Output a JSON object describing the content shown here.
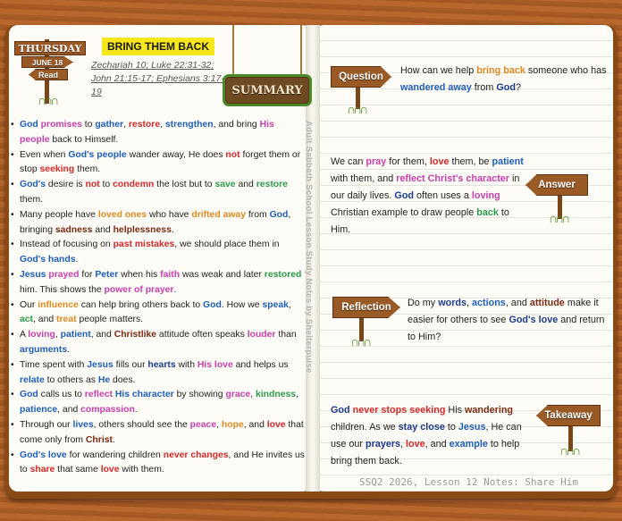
{
  "header": {
    "day": "THURSDAY",
    "date": "JUNE 18",
    "read_label": "Read",
    "title": "BRING THEM BACK",
    "scripture": "Zechariah 10; Luke 22:31-32; John 21:15-17; Ephesians 3:17-19",
    "summary_label": "SUMMARY",
    "vertical_text": "Adult Sabbath School Lesson Study Notes by Shelterpuise"
  },
  "bullets": [
    [
      [
        "God",
        "blue"
      ],
      [
        " "
      ],
      [
        "promises",
        "pink"
      ],
      [
        " to "
      ],
      [
        "gather",
        "blue"
      ],
      [
        ", "
      ],
      [
        "restore",
        "red"
      ],
      [
        ", "
      ],
      [
        "strengthen",
        "blue"
      ],
      [
        ", and bring "
      ],
      [
        "His people",
        "pink"
      ],
      [
        " back to Himself."
      ]
    ],
    [
      [
        "Even when "
      ],
      [
        "God's people",
        "blue"
      ],
      [
        " wander away, He does "
      ],
      [
        "not",
        "red"
      ],
      [
        " forget them or stop "
      ],
      [
        "seeking",
        "red"
      ],
      [
        " them."
      ]
    ],
    [
      [
        "God's",
        "blue"
      ],
      [
        " desire is "
      ],
      [
        "not",
        "red"
      ],
      [
        " to "
      ],
      [
        "condemn",
        "red"
      ],
      [
        " the lost but to "
      ],
      [
        "save",
        "green"
      ],
      [
        " and "
      ],
      [
        "restore",
        "green"
      ],
      [
        " them."
      ]
    ],
    [
      [
        "Many people have "
      ],
      [
        "loved ones",
        "orange"
      ],
      [
        " who have "
      ],
      [
        "drifted away",
        "orange"
      ],
      [
        " from "
      ],
      [
        "God",
        "blue"
      ],
      [
        ", bringing "
      ],
      [
        "sadness",
        "dark"
      ],
      [
        " and "
      ],
      [
        "helplessness",
        "dark"
      ],
      [
        "."
      ]
    ],
    [
      [
        "Instead of focusing on "
      ],
      [
        "past mistakes",
        "red"
      ],
      [
        ", we should place them in "
      ],
      [
        "God's hands",
        "blue"
      ],
      [
        "."
      ]
    ],
    [
      [
        "Jesus",
        "blue"
      ],
      [
        " "
      ],
      [
        "prayed",
        "pink"
      ],
      [
        " for "
      ],
      [
        "Peter",
        "blue"
      ],
      [
        " when his "
      ],
      [
        "faith",
        "pink"
      ],
      [
        " was weak and later "
      ],
      [
        "restored",
        "green"
      ],
      [
        " him. This shows the "
      ],
      [
        "power of prayer",
        "pink"
      ],
      [
        "."
      ]
    ],
    [
      [
        "Our "
      ],
      [
        "influence",
        "orange"
      ],
      [
        " can help bring others back to "
      ],
      [
        "God",
        "blue"
      ],
      [
        ". How we "
      ],
      [
        "speak",
        "blue"
      ],
      [
        ", "
      ],
      [
        "act",
        "green"
      ],
      [
        ", and "
      ],
      [
        "treat",
        "orange"
      ],
      [
        " people matters."
      ]
    ],
    [
      [
        "A "
      ],
      [
        "loving",
        "pink"
      ],
      [
        ", "
      ],
      [
        "patient",
        "blue"
      ],
      [
        ", and "
      ],
      [
        "Christlike",
        "dark"
      ],
      [
        " attitude often speaks "
      ],
      [
        "louder",
        "pink"
      ],
      [
        " than "
      ],
      [
        "arguments",
        "blue"
      ],
      [
        "."
      ]
    ],
    [
      [
        "Time spent with "
      ],
      [
        "Jesus",
        "blue"
      ],
      [
        " fills our "
      ],
      [
        "hearts",
        "dblue"
      ],
      [
        " with "
      ],
      [
        "His love",
        "pink"
      ],
      [
        " and helps us "
      ],
      [
        "relate",
        "blue"
      ],
      [
        " to others as "
      ],
      [
        "He",
        "blue"
      ],
      [
        " does."
      ]
    ],
    [
      [
        "God",
        "blue"
      ],
      [
        " calls us to "
      ],
      [
        "reflect",
        "pink"
      ],
      [
        " "
      ],
      [
        "His character",
        "blue"
      ],
      [
        " by showing "
      ],
      [
        "grace",
        "pink"
      ],
      [
        ", "
      ],
      [
        "kindness",
        "green"
      ],
      [
        ", "
      ],
      [
        "patience",
        "blue"
      ],
      [
        ", and "
      ],
      [
        "compassion",
        "pink"
      ],
      [
        "."
      ]
    ],
    [
      [
        "Through our "
      ],
      [
        "lives",
        "blue"
      ],
      [
        ", others should see the "
      ],
      [
        "peace",
        "pink"
      ],
      [
        ", "
      ],
      [
        "hope",
        "orange"
      ],
      [
        ", and "
      ],
      [
        "love",
        "red"
      ],
      [
        " that come only from "
      ],
      [
        "Christ",
        "dark"
      ],
      [
        "."
      ]
    ],
    [
      [
        "God's love",
        "blue"
      ],
      [
        " for wandering children "
      ],
      [
        "never changes",
        "red"
      ],
      [
        ", and He invites us to "
      ],
      [
        "share",
        "red"
      ],
      [
        " that same "
      ],
      [
        "love",
        "red"
      ],
      [
        " with them."
      ]
    ]
  ],
  "question": {
    "label": "Question",
    "text": [
      [
        "How can we help "
      ],
      [
        "bring back",
        "orange"
      ],
      [
        " someone who has "
      ],
      [
        "wandered away",
        "blue"
      ],
      [
        " from "
      ],
      [
        "God",
        "dblue"
      ],
      [
        "?"
      ]
    ]
  },
  "answer": {
    "label": "Answer",
    "text": [
      [
        "We can "
      ],
      [
        "pray",
        "pink"
      ],
      [
        " for them, "
      ],
      [
        "love",
        "red"
      ],
      [
        " them, be "
      ],
      [
        "patient",
        "blue"
      ],
      [
        " with them, and "
      ],
      [
        "reflect Christ's character",
        "pink"
      ],
      [
        " in our daily lives. "
      ],
      [
        "God",
        "dblue"
      ],
      [
        " often uses a "
      ],
      [
        "loving",
        "pink"
      ],
      [
        " Christian example to draw people "
      ],
      [
        "back",
        "green"
      ],
      [
        " to Him."
      ]
    ]
  },
  "reflection": {
    "label": "Reflection",
    "text": [
      [
        "Do my "
      ],
      [
        "words",
        "dblue"
      ],
      [
        ", "
      ],
      [
        "actions",
        "blue"
      ],
      [
        ", and "
      ],
      [
        "attitude",
        "dark"
      ],
      [
        " make it easier for others to see "
      ],
      [
        "God's love",
        "dblue"
      ],
      [
        " and return to Him?"
      ]
    ]
  },
  "takeaway": {
    "label": "Takeaway",
    "text": [
      [
        "God",
        "dblue"
      ],
      [
        " "
      ],
      [
        "never stops seeking",
        "red"
      ],
      [
        " His "
      ],
      [
        "wandering",
        "dark"
      ],
      [
        " children. As we "
      ],
      [
        "stay close",
        "dblue"
      ],
      [
        " to "
      ],
      [
        "Jesus",
        "blue"
      ],
      [
        ", He can use our "
      ],
      [
        "prayers",
        "dblue"
      ],
      [
        ", "
      ],
      [
        "love",
        "red"
      ],
      [
        ", and "
      ],
      [
        "example",
        "blue"
      ],
      [
        " to help bring them back."
      ]
    ]
  },
  "footer": "SSQ2 2026, Lesson 12 Notes: Share Him",
  "colors": {
    "blue": "#1f5fb8",
    "pink": "#c83fb0",
    "red": "#d42a2a",
    "green": "#2e9b4a",
    "orange": "#e08a24",
    "dark": "#7a2a10",
    "dblue": "#1a3a8a"
  }
}
